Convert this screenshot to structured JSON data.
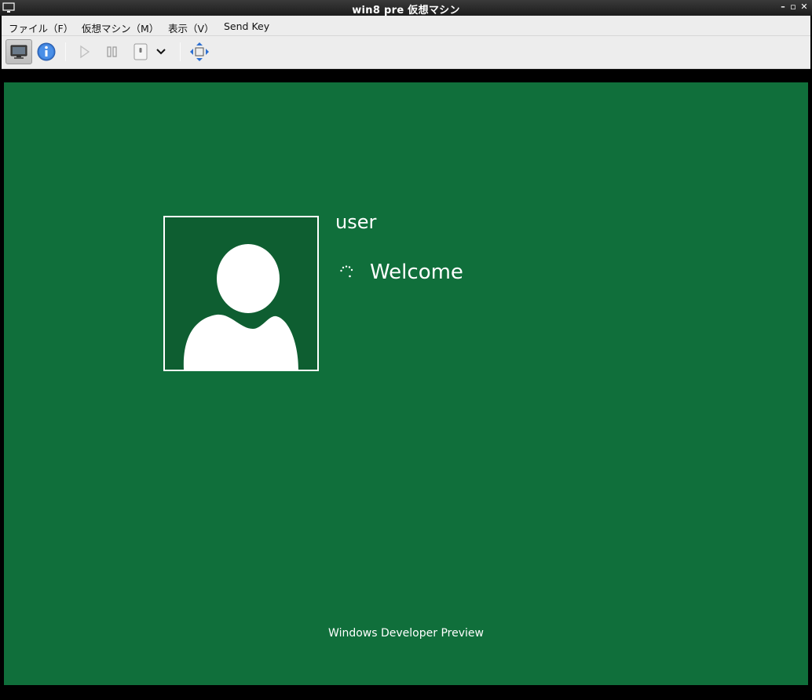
{
  "window": {
    "title": "win8 pre 仮想マシン",
    "icon": "monitor-icon",
    "controls": [
      "minimize-icon",
      "maximize-icon",
      "close-icon"
    ]
  },
  "menubar": {
    "items": [
      {
        "label": "ファイル（F）"
      },
      {
        "label": "仮想マシン（M）"
      },
      {
        "label": "表示（V）"
      },
      {
        "label": "Send Key"
      }
    ]
  },
  "toolbar": {
    "buttons": [
      {
        "icon": "console-monitor-icon",
        "active": true
      },
      {
        "icon": "info-icon",
        "active": false
      },
      {
        "icon": "run-icon",
        "enabled": false
      },
      {
        "icon": "pause-icon",
        "enabled": false
      },
      {
        "icon": "shutdown-icon",
        "enabled": false
      },
      {
        "icon": "dropdown-chevron-icon"
      },
      {
        "icon": "fullscreen-icon"
      }
    ]
  },
  "guest": {
    "username": "user",
    "status": "Welcome",
    "footer": "Windows Developer Preview",
    "colors": {
      "background": "#106f3b",
      "avatar_background": "#0e5e31",
      "text": "#ffffff"
    }
  }
}
